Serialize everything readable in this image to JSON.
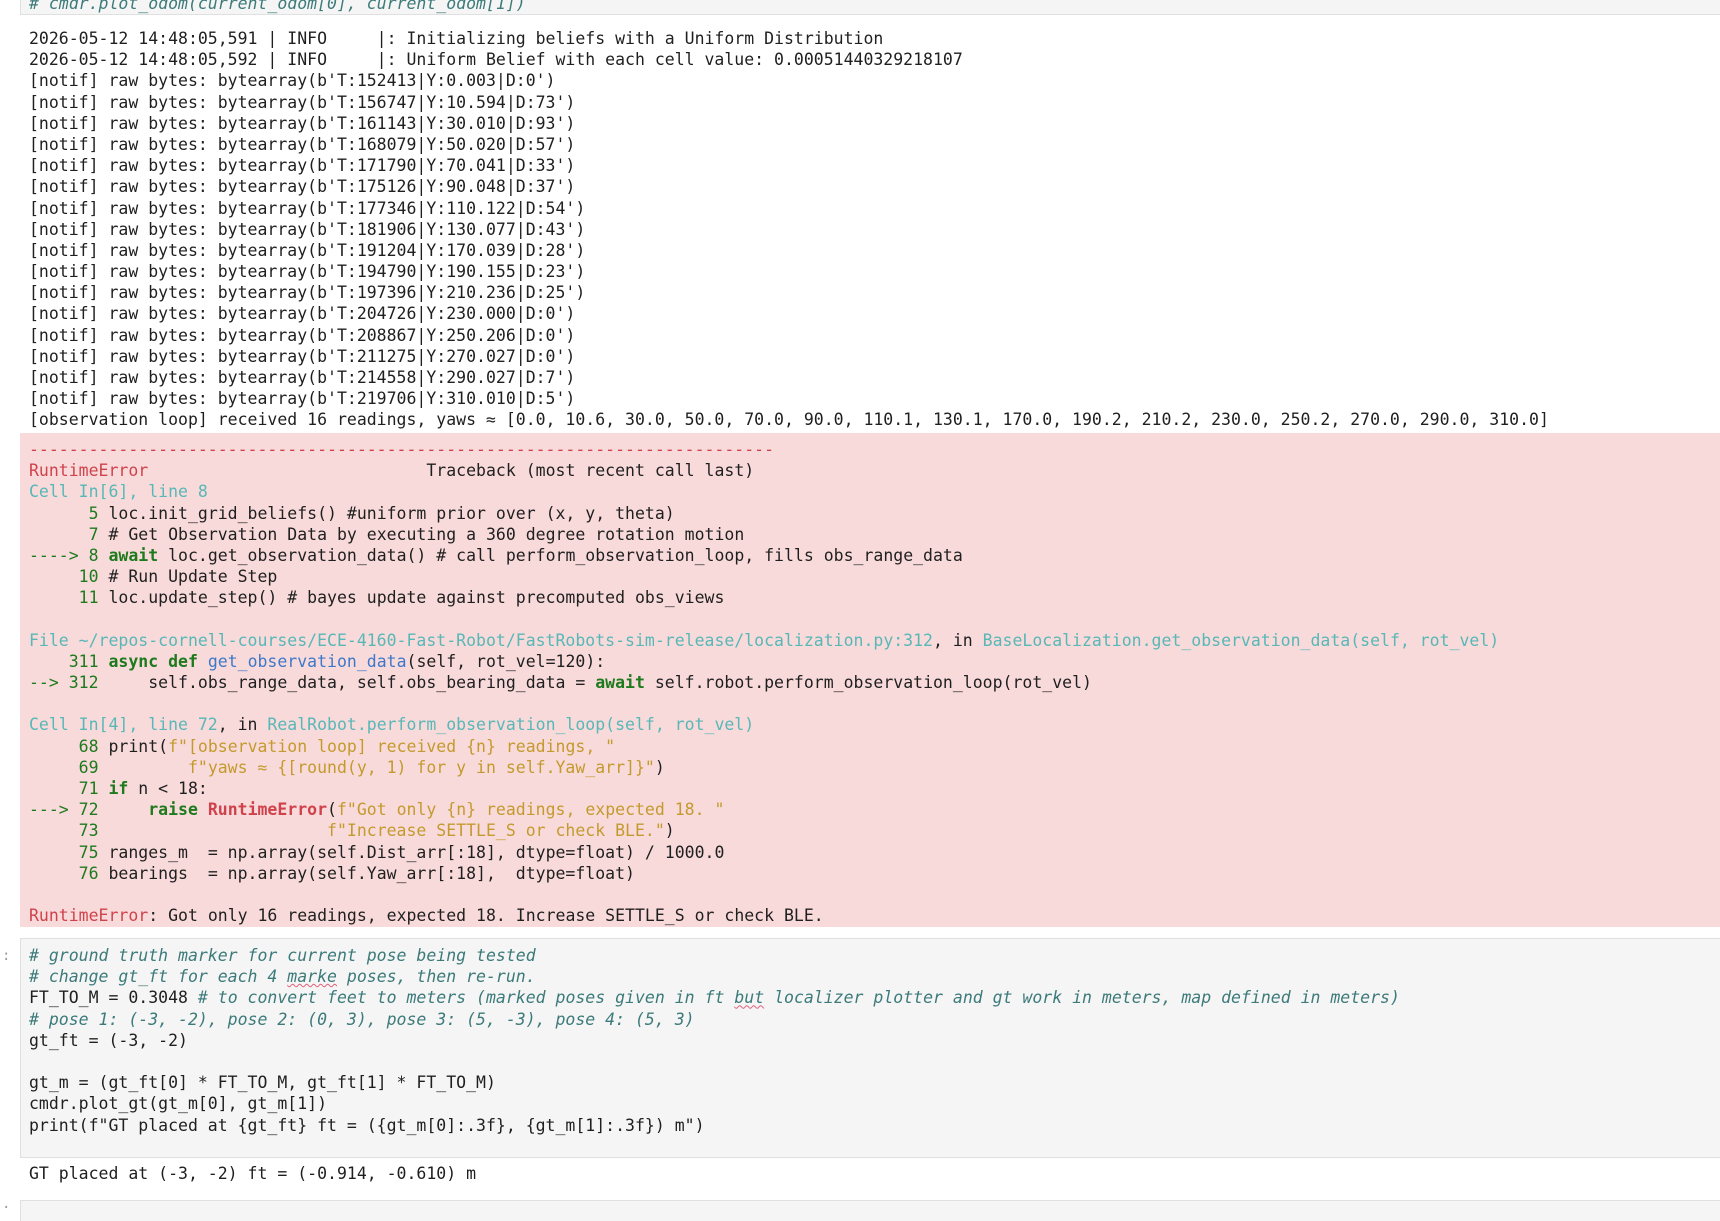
{
  "top_cell_code": "# cmdr.plot_odom(current_odom[0], current_odom[1])",
  "log_lines": [
    "2026-05-12 14:48:05,591 | INFO     |: Initializing beliefs with a Uniform Distribution",
    "2026-05-12 14:48:05,592 | INFO     |: Uniform Belief with each cell value: 0.00051440329218107",
    "[notif] raw bytes: bytearray(b'T:152413|Y:0.003|D:0')",
    "[notif] raw bytes: bytearray(b'T:156747|Y:10.594|D:73')",
    "[notif] raw bytes: bytearray(b'T:161143|Y:30.010|D:93')",
    "[notif] raw bytes: bytearray(b'T:168079|Y:50.020|D:57')",
    "[notif] raw bytes: bytearray(b'T:171790|Y:70.041|D:33')",
    "[notif] raw bytes: bytearray(b'T:175126|Y:90.048|D:37')",
    "[notif] raw bytes: bytearray(b'T:177346|Y:110.122|D:54')",
    "[notif] raw bytes: bytearray(b'T:181906|Y:130.077|D:43')",
    "[notif] raw bytes: bytearray(b'T:191204|Y:170.039|D:28')",
    "[notif] raw bytes: bytearray(b'T:194790|Y:190.155|D:23')",
    "[notif] raw bytes: bytearray(b'T:197396|Y:210.236|D:25')",
    "[notif] raw bytes: bytearray(b'T:204726|Y:230.000|D:0')",
    "[notif] raw bytes: bytearray(b'T:208867|Y:250.206|D:0')",
    "[notif] raw bytes: bytearray(b'T:211275|Y:270.027|D:0')",
    "[notif] raw bytes: bytearray(b'T:214558|Y:290.027|D:7')",
    "[notif] raw bytes: bytearray(b'T:219706|Y:310.010|D:5')",
    "[observation loop] received 16 readings, yaws ≈ [0.0, 10.6, 30.0, 50.0, 70.0, 90.0, 110.1, 130.1, 170.0, 190.2, 210.2, 230.0, 250.2, 270.0, 290.0, 310.0]"
  ],
  "traceback": {
    "dashes": "---------------------------------------------------------------------------",
    "error_name": "RuntimeError",
    "header_right": "Traceback (most recent call last)",
    "frame1_label": "Cell In[6], line 8",
    "frame1_lines": {
      "l5_no": "      5",
      "l5_code": " loc.init_grid_beliefs() #uniform prior over (x, y, theta)",
      "l7_no": "      7",
      "l7_code": " # Get Observation Data by executing a 360 degree rotation motion",
      "l8_arrow": "----> 8",
      "l8_kw": "await",
      "l8_code": " loc.get_observation_data() # call perform_observation_loop, fills obs_range_data",
      "l10_no": "     10",
      "l10_code": " # Run Update Step",
      "l11_no": "     11",
      "l11_code": " loc.update_step() # bayes update against precomputed obs_views"
    },
    "frame2_prefix": "File ",
    "frame2_path": "~/repos-cornell-courses/ECE-4160-Fast-Robot/FastRobots-sim-release/localization.py:312",
    "frame2_in": ", in ",
    "frame2_func": "BaseLocalization.get_observation_data(self, rot_vel)",
    "frame2_l311_no": "    311",
    "frame2_l311_kw": "async def",
    "frame2_l311_fn": "get_observation_data",
    "frame2_l311_rest": "(self, rot_vel=120):",
    "frame2_l312_arrow": "--> 312",
    "frame2_l312_code": "     self.obs_range_data, self.obs_bearing_data = ",
    "frame2_l312_kw": "await",
    "frame2_l312_rest": " self.robot.perform_observation_loop(rot_vel)",
    "frame3_label": "Cell In[4], line 72",
    "frame3_in": ", in ",
    "frame3_func": "RealRobot.perform_observation_loop(self, rot_vel)",
    "f3_68_no": "     68",
    "f3_68_a": " print(",
    "f3_68_s": "f\"[observation loop] received {n} readings, \"",
    "f3_69_no": "     69",
    "f3_69_s": "         f\"yaws ≈ {[round(y, 1) for y in self.Yaw_arr]}\"",
    "f3_69_end": ")",
    "f3_71_no": "     71",
    "f3_71_kw": "if",
    "f3_71_rest": " n < 18:",
    "f3_72_arrow": "---> 72",
    "f3_72_kw": "raise",
    "f3_72_err": "RuntimeError",
    "f3_72_s": "f\"Got only {n} readings, expected 18. \"",
    "f3_73_no": "     73",
    "f3_73_s": "                       f\"Increase SETTLE_S or check BLE.\"",
    "f3_73_end": ")",
    "f3_75_no": "     75",
    "f3_75_code": " ranges_m  = np.array(self.Dist_arr[:18], dtype=float) / 1000.0",
    "f3_76_no": "     76",
    "f3_76_code": " bearings  = np.array(self.Yaw_arr[:18],  dtype=float)",
    "final_name": "RuntimeError",
    "final_msg": ": Got only 16 readings, expected 18. Increase SETTLE_S or check BLE."
  },
  "code_cell": {
    "c1": "# ground truth marker for current pose being tested",
    "c2a": "# change gt_ft for each 4 ",
    "c2b": "marke",
    "c2c": " poses, then re-run.",
    "c3a": "FT_TO_M = 0.3048",
    "c3b": " # to convert feet to meters (marked poses given in ft ",
    "c3c": "but",
    "c3d": " localizer plotter and gt work in meters, map defined in meters)",
    "c4": "# pose 1: (-3, -2), pose 2: (0, 3), pose 3: (5, -3), pose 4: (5, 3)",
    "c5": "gt_ft = (-3, -2)",
    "c7": "gt_m = (gt_ft[0] * FT_TO_M, gt_ft[1] * FT_TO_M)",
    "c8": "cmdr.plot_gt(gt_m[0], gt_m[1])",
    "c9": "print(f\"GT placed at {gt_ft} ft = ({gt_m[0]:.3f}, {gt_m[1]:.3f}) m\")"
  },
  "final_output": "GT placed at (-3, -2) ft = (-0.914, -0.610) m"
}
